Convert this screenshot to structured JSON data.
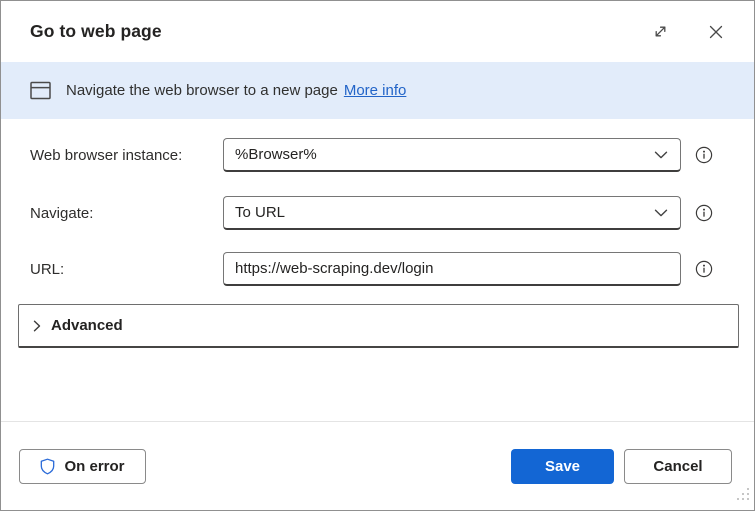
{
  "dialog": {
    "title": "Go to web page",
    "banner": {
      "text": "Navigate the web browser to a new page",
      "link_label": "More info"
    },
    "fields": [
      {
        "label": "Web browser instance:",
        "value": "%Browser%",
        "type": "dropdown"
      },
      {
        "label": "Navigate:",
        "value": "To URL",
        "type": "dropdown"
      },
      {
        "label": "URL:",
        "value": "https://web-scraping.dev/login",
        "type": "text"
      }
    ],
    "advanced": {
      "label": "Advanced",
      "expanded": false
    },
    "footer": {
      "on_error_label": "On error",
      "save_label": "Save",
      "cancel_label": "Cancel"
    }
  },
  "icons": {
    "browser_window": "window-with-titlebar outline",
    "expand": "diagonal-double-arrow",
    "close": "x-cross",
    "chevron_down": "v-chevron",
    "chevron_right": "right-chevron",
    "info": "circled-i",
    "shield": "shield-outline",
    "resize_grip": "corner-dot-triangle"
  },
  "colors": {
    "banner_bg": "#e2ecfa",
    "link_blue": "#2264c8",
    "primary_blue": "#1366d4",
    "shield_blue": "#2b6bd8",
    "icon_gray": "#424242",
    "border_gray": "#767676"
  }
}
